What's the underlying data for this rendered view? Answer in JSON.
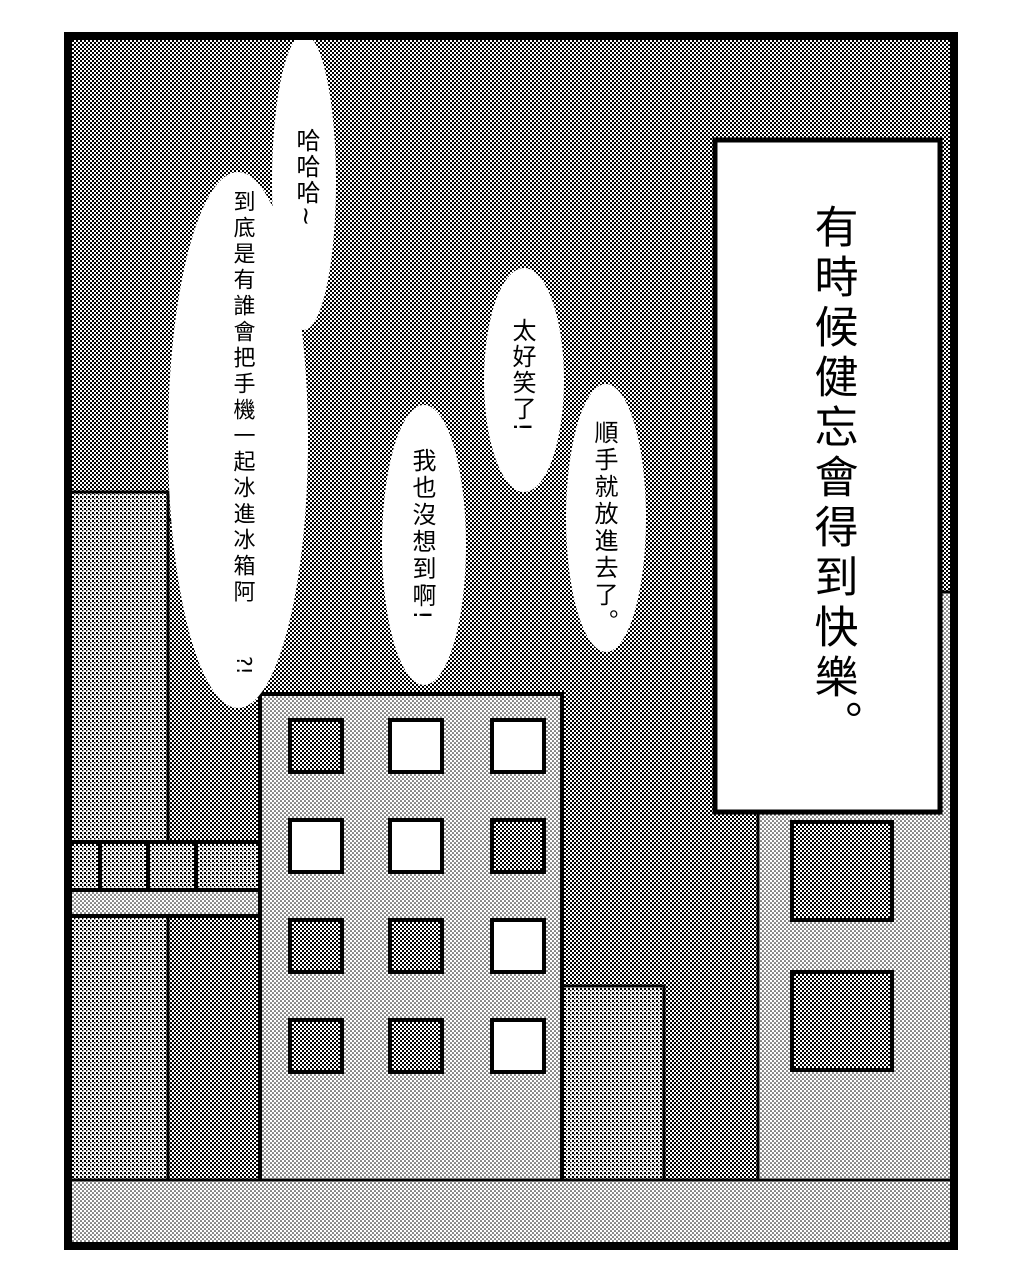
{
  "narration": {
    "line1": "有時候健忘會得到快樂",
    "line2": "。"
  },
  "bubbles": {
    "laugh": "哈哈哈~",
    "who": {
      "col1": "到底是有誰會把手機一起冰進冰箱阿",
      "col2": "?!"
    },
    "funny": "太好笑了!",
    "never": "我也沒想到啊!",
    "casual": "順手就放進去了。"
  },
  "colors": {
    "ink": "#000000",
    "paper": "#ffffff"
  }
}
